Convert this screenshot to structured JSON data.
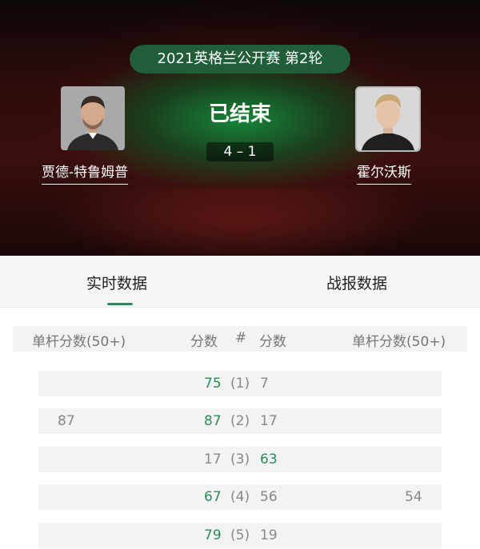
{
  "header": {
    "tournament": "2021英格兰公开赛 第2轮",
    "status": "已结束",
    "score": "4 – 1",
    "player_left": "贾德-特鲁姆普",
    "player_right": "霍尔沃斯"
  },
  "tabs": [
    {
      "label": "实时数据",
      "active": true
    },
    {
      "label": "战报数据",
      "active": false
    }
  ],
  "table": {
    "headers": {
      "left_break": "单杆分数(50+)",
      "left_score": "分数",
      "frame": "#",
      "right_score": "分数",
      "right_break": "单杆分数(50+)"
    },
    "rows": [
      {
        "left_break": "",
        "left_score": "75",
        "frame": "(1)",
        "right_score": "7",
        "right_break": "",
        "winner": "left"
      },
      {
        "left_break": "87",
        "left_score": "87",
        "frame": "(2)",
        "right_score": "17",
        "right_break": "",
        "winner": "left"
      },
      {
        "left_break": "",
        "left_score": "17",
        "frame": "(3)",
        "right_score": "63",
        "right_break": "",
        "winner": "right"
      },
      {
        "left_break": "",
        "left_score": "67",
        "frame": "(4)",
        "right_score": "56",
        "right_break": "54",
        "winner": "left"
      },
      {
        "left_break": "",
        "left_score": "79",
        "frame": "(5)",
        "right_score": "19",
        "right_break": "",
        "winner": "left"
      }
    ]
  },
  "colors": {
    "accent_green": "#2e8b57",
    "pill_green": "#1f5e38"
  }
}
